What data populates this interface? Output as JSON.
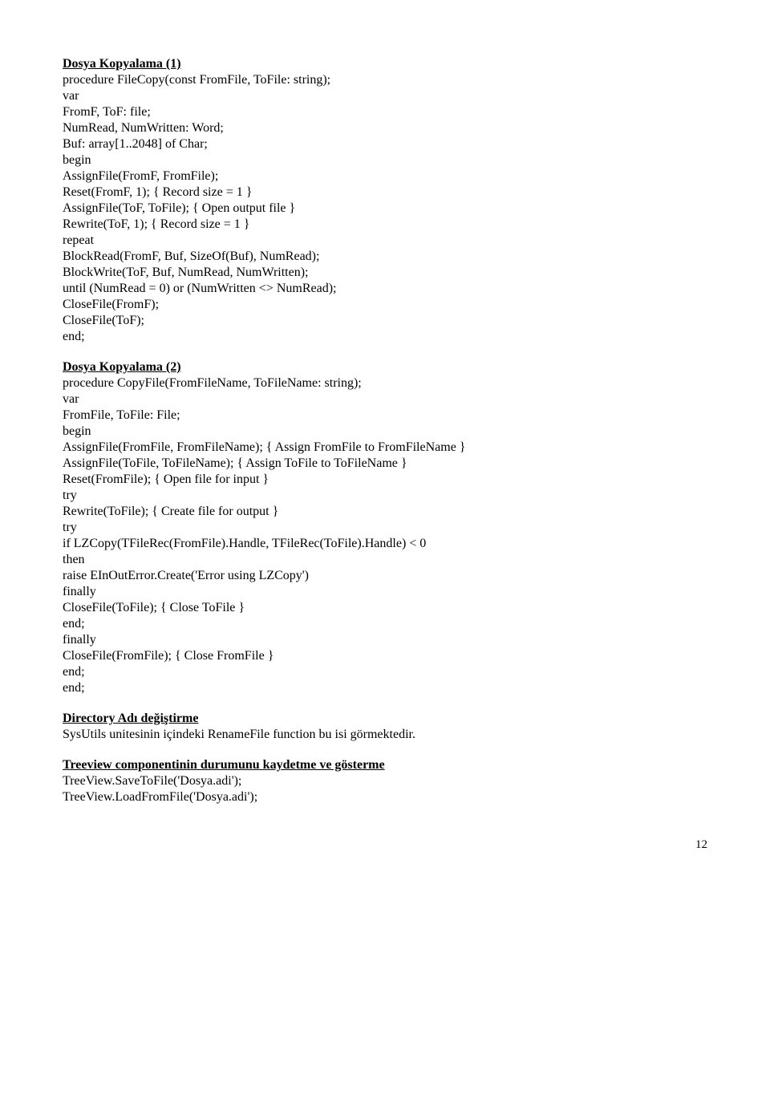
{
  "section1": {
    "heading": "Dosya Kopyalama (1)",
    "lines": [
      "procedure FileCopy(const FromFile, ToFile: string);",
      "var",
      "FromF, ToF: file;",
      "NumRead, NumWritten: Word;",
      "Buf: array[1..2048] of Char;",
      "begin",
      "AssignFile(FromF, FromFile);",
      "Reset(FromF, 1); { Record size = 1 }",
      "AssignFile(ToF, ToFile); { Open output file }",
      "Rewrite(ToF, 1); { Record size = 1 }",
      "repeat",
      "BlockRead(FromF, Buf, SizeOf(Buf), NumRead);",
      "BlockWrite(ToF, Buf, NumRead, NumWritten);",
      "until (NumRead = 0) or (NumWritten <> NumRead);",
      "CloseFile(FromF);",
      "CloseFile(ToF);",
      "end;"
    ]
  },
  "section2": {
    "heading": "Dosya Kopyalama (2)",
    "lines": [
      "procedure CopyFile(FromFileName, ToFileName: string);",
      "var",
      "FromFile, ToFile: File;",
      "begin",
      "AssignFile(FromFile, FromFileName); { Assign FromFile to FromFileName }",
      "AssignFile(ToFile, ToFileName); { Assign ToFile to ToFileName }",
      "Reset(FromFile); { Open file for input }",
      "try",
      "Rewrite(ToFile); { Create file for output }",
      "try",
      "if LZCopy(TFileRec(FromFile).Handle, TFileRec(ToFile).Handle) < 0",
      "then",
      "raise EInOutError.Create('Error using LZCopy')",
      "finally",
      "CloseFile(ToFile); { Close ToFile }",
      "end;",
      "finally",
      "CloseFile(FromFile); { Close FromFile }",
      "end;",
      "end;"
    ]
  },
  "section3": {
    "heading": "Directory Adı değiştirme",
    "lines": [
      "SysUtils unitesinin içindeki RenameFile function bu isi görmektedir."
    ]
  },
  "section4": {
    "heading": "Treeview componentinin durumunu kaydetme ve gösterme",
    "lines": [
      "TreeView.SaveToFile('Dosya.adi');",
      "TreeView.LoadFromFile('Dosya.adi');"
    ]
  },
  "pageNumber": "12"
}
